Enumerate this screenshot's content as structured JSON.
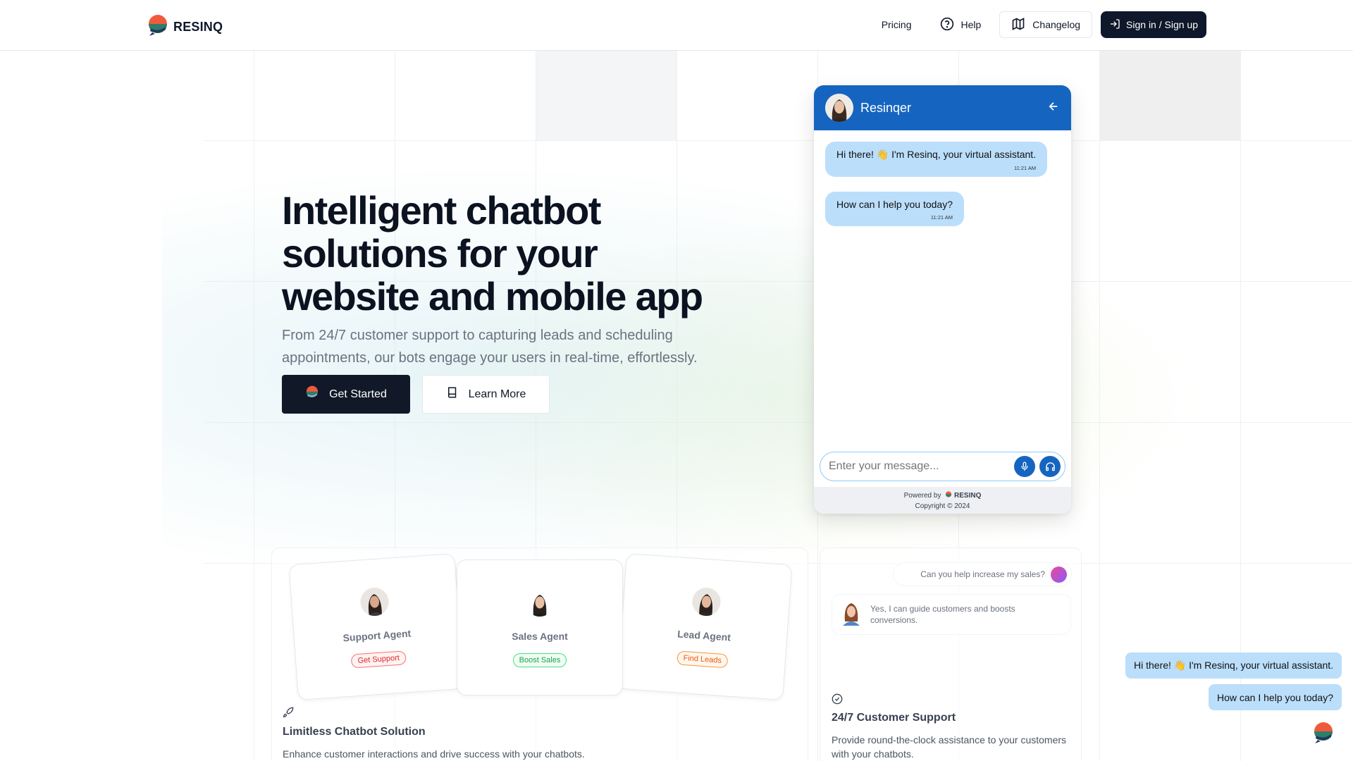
{
  "brand": {
    "name": "RESINQ"
  },
  "nav": {
    "pricing": "Pricing",
    "help": "Help",
    "changelog": "Changelog",
    "signin": "Sign in / Sign up"
  },
  "hero": {
    "title": "Intelligent chatbot solutions for your website and mobile app",
    "subtitle": "From 24/7 customer support to capturing leads and scheduling appointments, our bots engage your users in real-time, effortlessly.",
    "get_started": "Get Started",
    "learn_more": "Learn More"
  },
  "chat": {
    "bot_name": "Resinqer",
    "messages": [
      {
        "text": "Hi there! 👋 I'm Resinq, your virtual assistant.",
        "time": "11:21 AM"
      },
      {
        "text": "How can I help you today?",
        "time": "11:21 AM"
      }
    ],
    "input_placeholder": "Enter your message...",
    "powered_by": "Powered by",
    "powered_brand": "RESINQ",
    "copyright": "Copyright © 2024",
    "accent": "#1565c0",
    "bubble_color": "#bbdefb"
  },
  "features": {
    "agents": [
      {
        "label": "Support Agent",
        "tag": "Get Support"
      },
      {
        "label": "Sales Agent",
        "tag": "Boost Sales"
      },
      {
        "label": "Lead Agent",
        "tag": "Find Leads"
      }
    ],
    "left_title": "Limitless Chatbot Solution",
    "left_desc": "Enhance customer interactions and drive success with your chatbots.",
    "demo_question": "Can you help increase my sales?",
    "demo_answer": "Yes, I can guide customers and boosts conversions.",
    "right_title": "24/7 Customer Support",
    "right_desc": "Provide round-the-clock assistance to your customers with your chatbots."
  },
  "floating": {
    "messages": [
      "Hi there! 👋 I'm Resinq, your virtual assistant.",
      "How can I help you today?"
    ]
  },
  "icons": [
    "logo-icon",
    "help-circle-icon",
    "map-icon",
    "sign-in-icon",
    "book-icon",
    "arrow-left-icon",
    "mic-icon",
    "headset-icon",
    "rocket-icon",
    "check-circle-icon",
    "launcher-icon"
  ]
}
